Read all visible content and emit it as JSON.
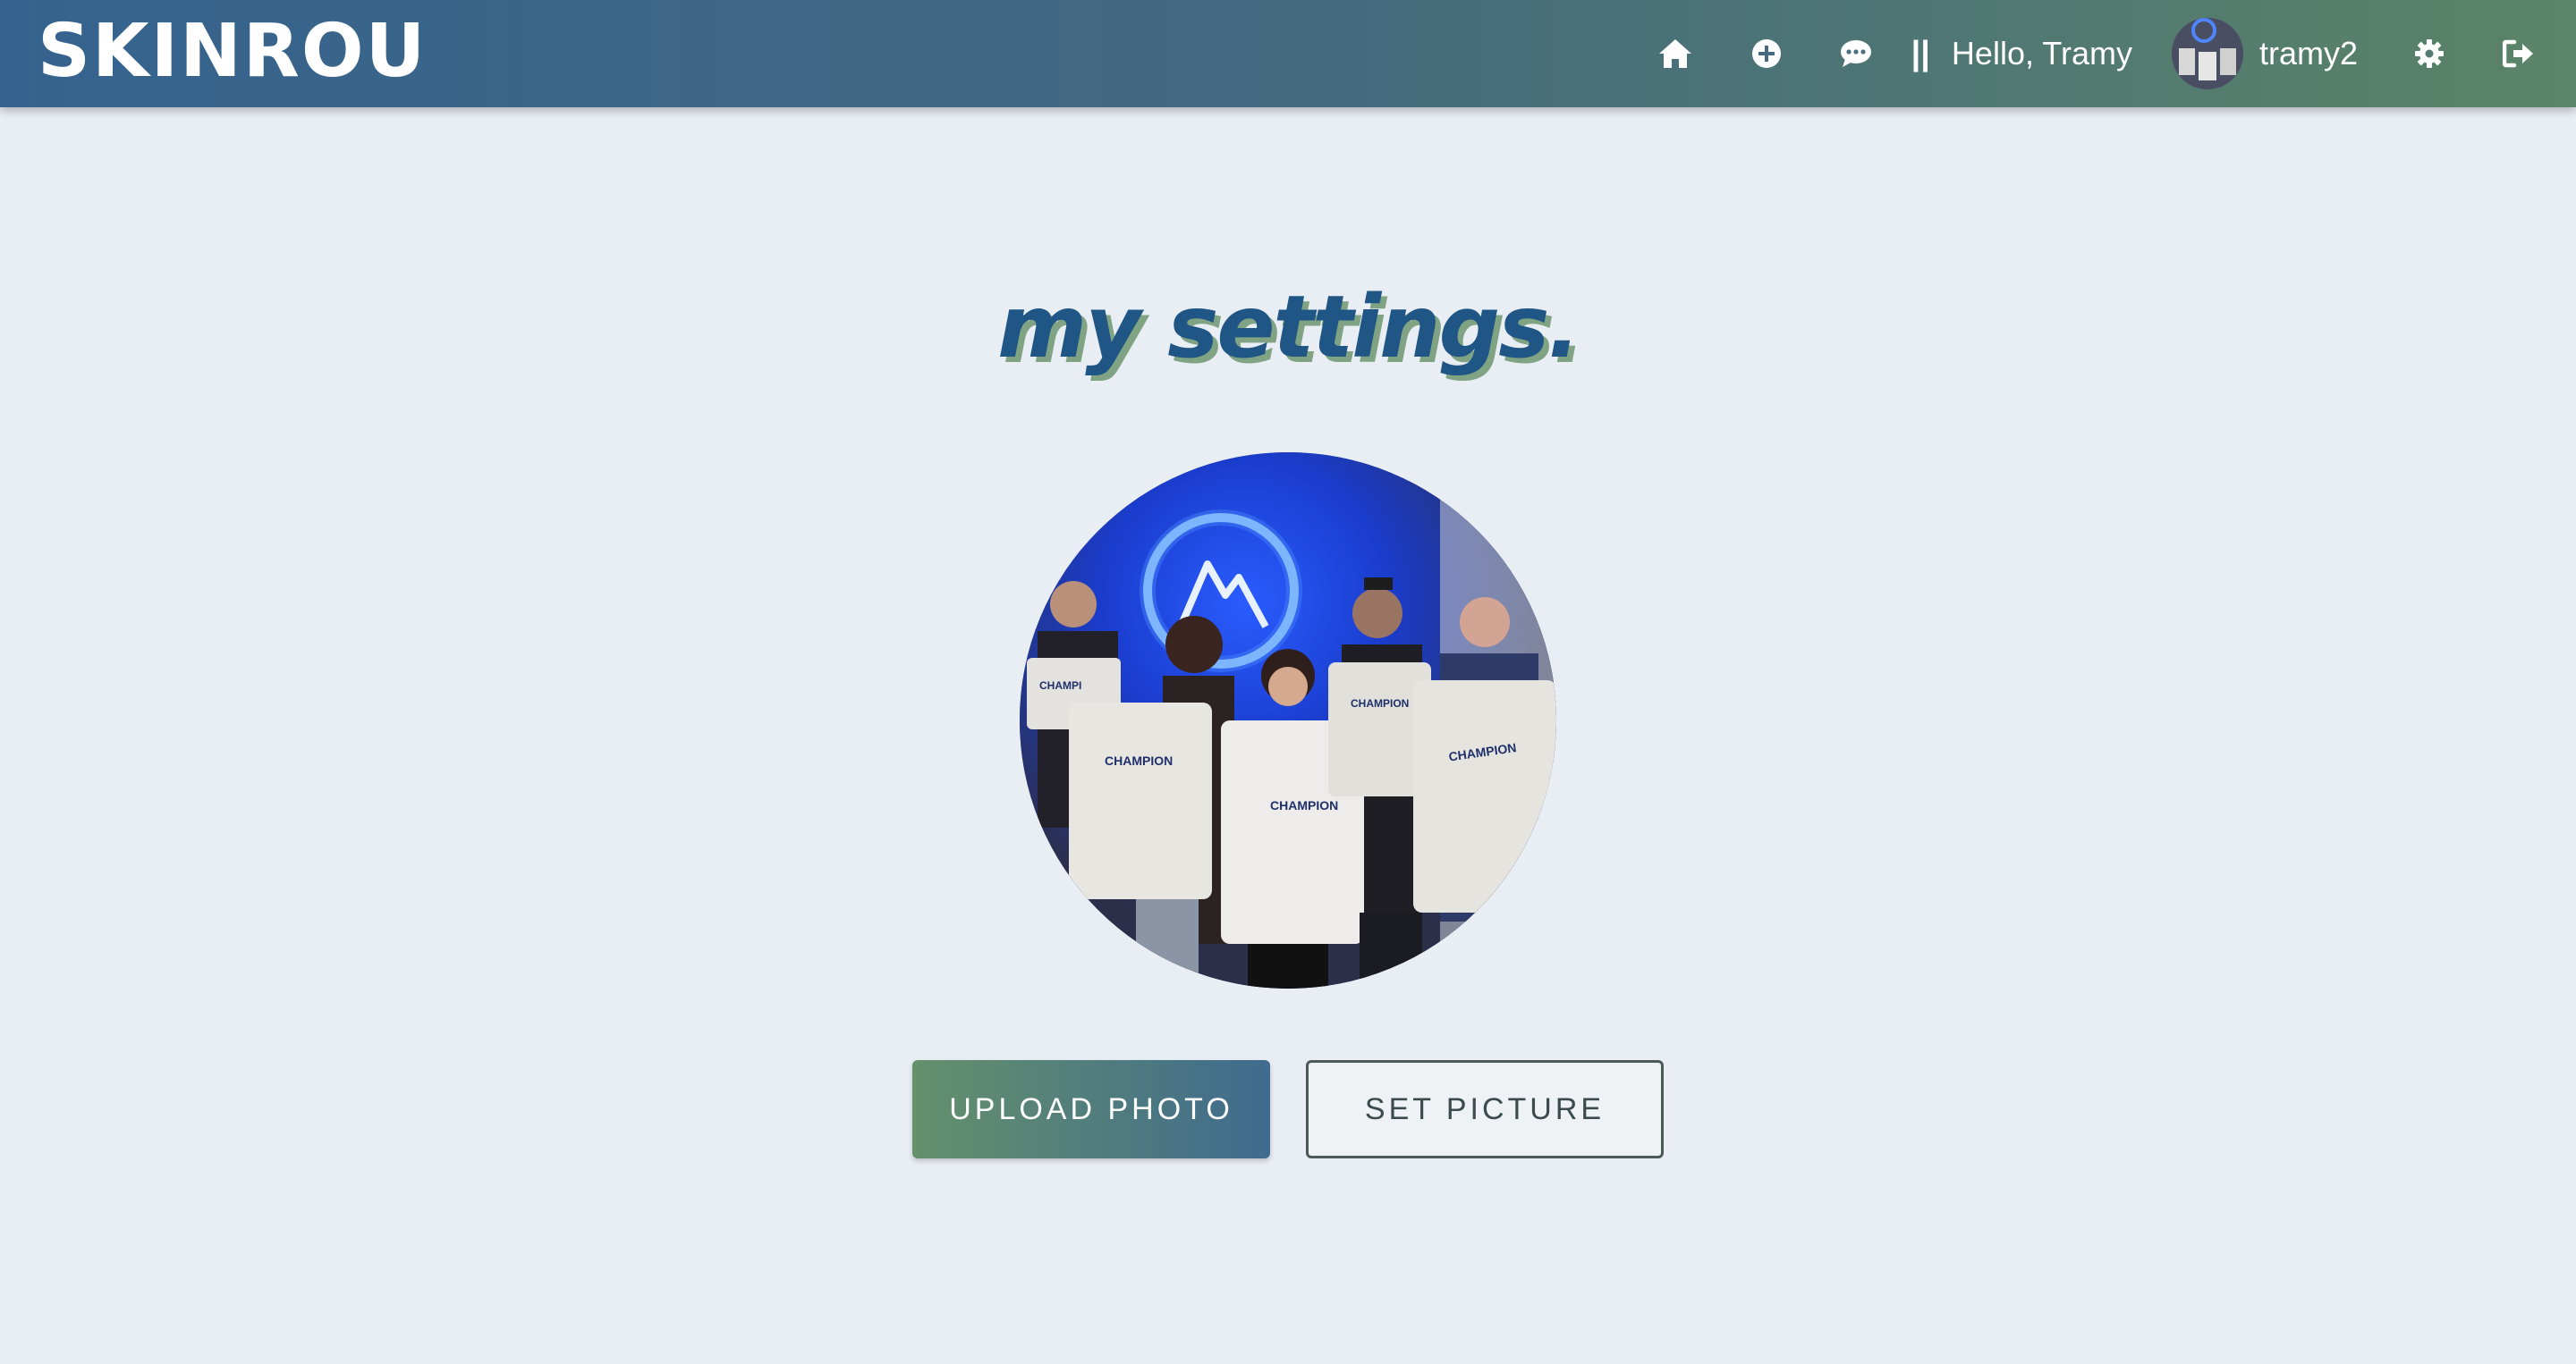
{
  "header": {
    "brand": "SKINROU",
    "greeting": "Hello, Tramy",
    "separator": "||",
    "username": "tramy2",
    "icons": [
      "home-icon",
      "plus-circle-icon",
      "chat-icon",
      "gear-icon",
      "sign-out-icon"
    ]
  },
  "main": {
    "title": "my settings.",
    "upload_label": "UPLOAD PHOTO",
    "set_label": "SET PICTURE"
  },
  "colors": {
    "header_gradient_start": "#35638f",
    "header_gradient_end": "#5b8468",
    "title_color": "#1f5685",
    "title_shadow": "#7fa383",
    "background": "#e9eef4"
  }
}
